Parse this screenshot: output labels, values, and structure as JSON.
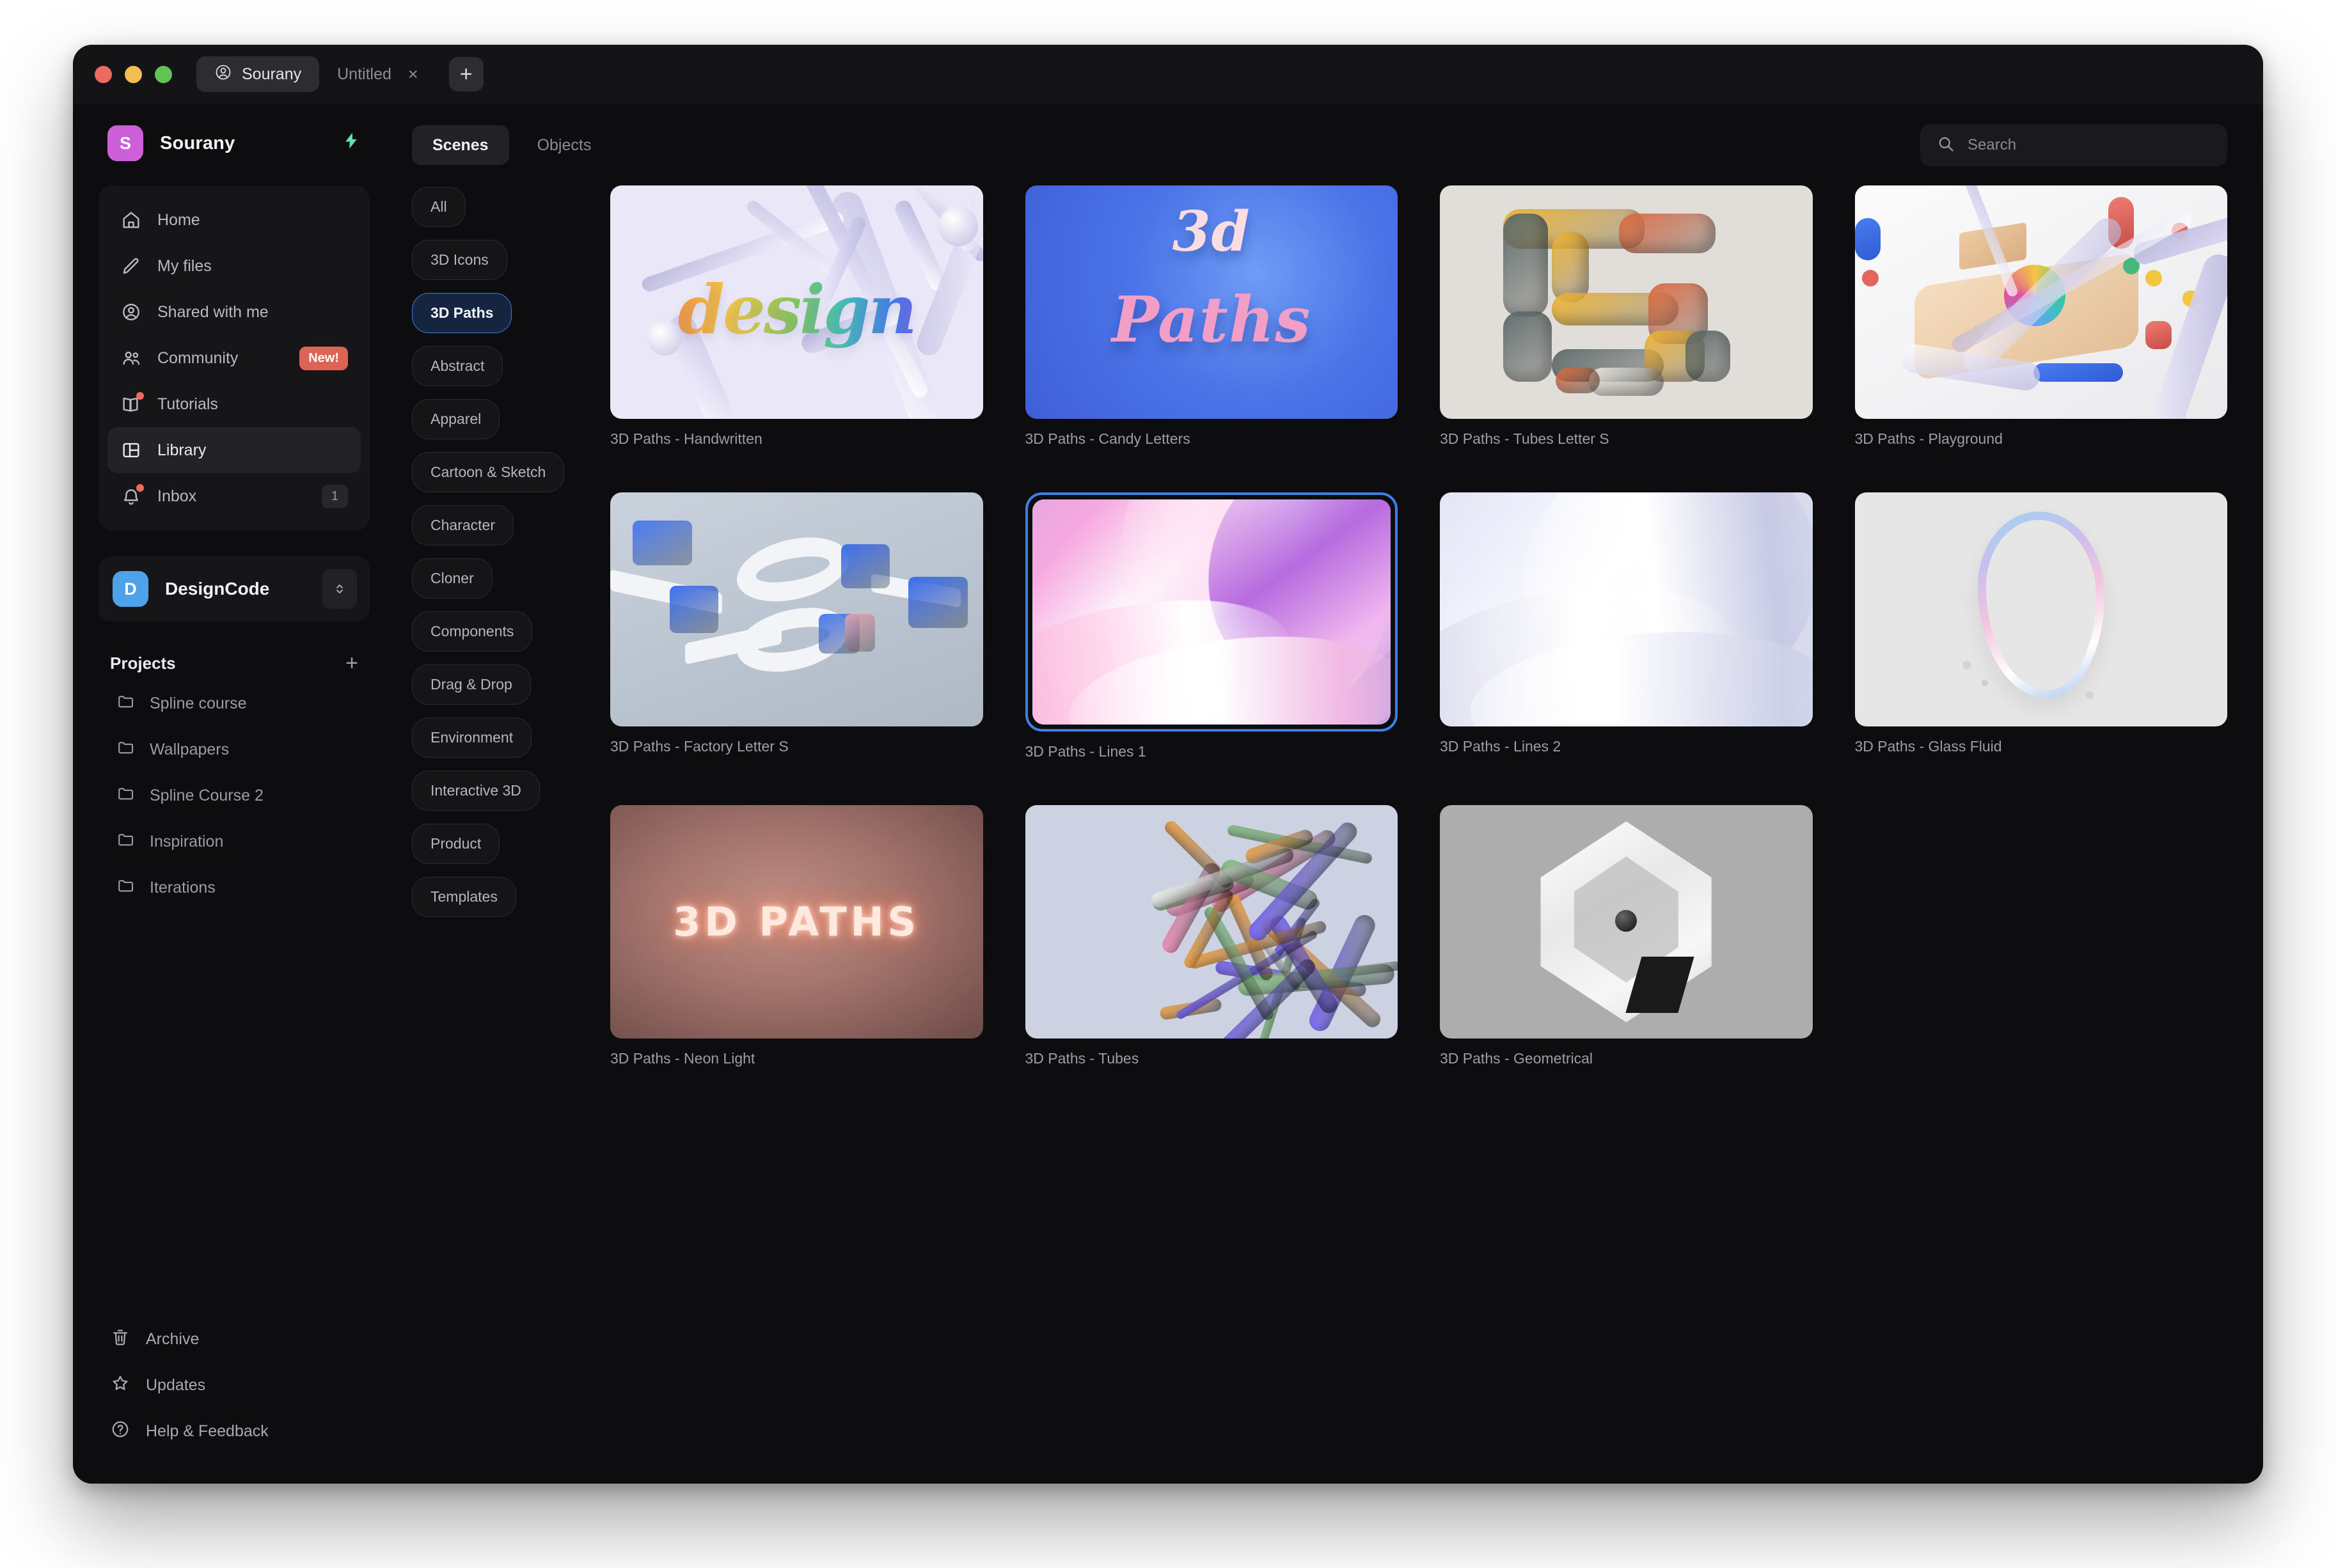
{
  "titlebar": {
    "account_tab": "Sourany",
    "file_tab": "Untitled",
    "close_tab_icon": "×",
    "new_tab_icon": "+"
  },
  "sidebar": {
    "workspace": {
      "initial": "S",
      "name": "Sourany",
      "avatar_color": "#cf5fd8",
      "bolt_icon": "lightning-icon"
    },
    "nav": [
      {
        "label": "Home",
        "icon": "home-icon",
        "selected": false,
        "badge": null,
        "dot": false
      },
      {
        "label": "My files",
        "icon": "pencil-icon",
        "selected": false,
        "badge": null,
        "dot": false
      },
      {
        "label": "Shared with me",
        "icon": "user-circle-icon",
        "selected": false,
        "badge": null,
        "dot": false
      },
      {
        "label": "Community",
        "icon": "users-icon",
        "selected": false,
        "badge": "New!",
        "dot": false
      },
      {
        "label": "Tutorials",
        "icon": "book-icon",
        "selected": false,
        "badge": null,
        "dot": true
      },
      {
        "label": "Library",
        "icon": "layout-icon",
        "selected": true,
        "badge": null,
        "dot": false
      },
      {
        "label": "Inbox",
        "icon": "bell-icon",
        "selected": false,
        "badge": "1",
        "dot": true
      }
    ],
    "team": {
      "initial": "D",
      "name": "DesignCode",
      "avatar_color": "#4da2ea",
      "switch_icon": "chevron-updown-icon"
    },
    "projects_title": "Projects",
    "projects_add_icon": "+",
    "projects": [
      {
        "label": "Spline course",
        "icon": "folder-icon"
      },
      {
        "label": "Wallpapers",
        "icon": "folder-icon"
      },
      {
        "label": "Spline Course 2",
        "icon": "folder-icon"
      },
      {
        "label": "Inspiration",
        "icon": "folder-icon"
      },
      {
        "label": "Iterations",
        "icon": "folder-icon"
      }
    ],
    "bottom": [
      {
        "label": "Archive",
        "icon": "trash-icon"
      },
      {
        "label": "Updates",
        "icon": "star-icon"
      },
      {
        "label": "Help & Feedback",
        "icon": "question-circle-icon"
      }
    ]
  },
  "main": {
    "tabs": [
      {
        "label": "Scenes",
        "active": true
      },
      {
        "label": "Objects",
        "active": false
      }
    ],
    "search": {
      "placeholder": "Search",
      "value": "",
      "icon": "search-icon"
    },
    "categories": [
      {
        "label": "All",
        "active": false
      },
      {
        "label": "3D Icons",
        "active": false
      },
      {
        "label": "3D Paths",
        "active": true
      },
      {
        "label": "Abstract",
        "active": false
      },
      {
        "label": "Apparel",
        "active": false
      },
      {
        "label": "Cartoon & Sketch",
        "active": false
      },
      {
        "label": "Character",
        "active": false
      },
      {
        "label": "Cloner",
        "active": false
      },
      {
        "label": "Components",
        "active": false
      },
      {
        "label": "Drag & Drop",
        "active": false
      },
      {
        "label": "Environment",
        "active": false
      },
      {
        "label": "Interactive 3D",
        "active": false
      },
      {
        "label": "Product",
        "active": false
      },
      {
        "label": "Templates",
        "active": false
      }
    ],
    "cards": [
      {
        "label": "3D Paths - Handwritten",
        "art": "handwritten",
        "selected": false,
        "word": "design"
      },
      {
        "label": "3D Paths - Candy Letters",
        "art": "candy",
        "selected": false,
        "line1": "3d",
        "line2": "Paths"
      },
      {
        "label": "3D Paths - Tubes Letter S",
        "art": "tubes",
        "selected": false
      },
      {
        "label": "3D Paths - Playground",
        "art": "playground",
        "selected": false
      },
      {
        "label": "3D Paths - Factory Letter S",
        "art": "factory",
        "selected": false
      },
      {
        "label": "3D Paths - Lines 1",
        "art": "lines1",
        "selected": true
      },
      {
        "label": "3D Paths - Lines 2",
        "art": "lines2",
        "selected": false
      },
      {
        "label": "3D Paths - Glass Fluid",
        "art": "glass",
        "selected": false
      },
      {
        "label": "3D Paths - Neon Light",
        "art": "neon",
        "selected": false,
        "word": "3D PATHS"
      },
      {
        "label": "3D Paths - Tubes",
        "art": "knot",
        "selected": false
      },
      {
        "label": "3D Paths - Geometrical",
        "art": "geometrical",
        "selected": false
      }
    ]
  },
  "colors": {
    "accent_blue": "#3b7fe8",
    "badge_red": "#dd6355",
    "bolt_green": "#5fe3b1",
    "window_bg": "#0d0d0f",
    "panel_bg": "#161619"
  }
}
